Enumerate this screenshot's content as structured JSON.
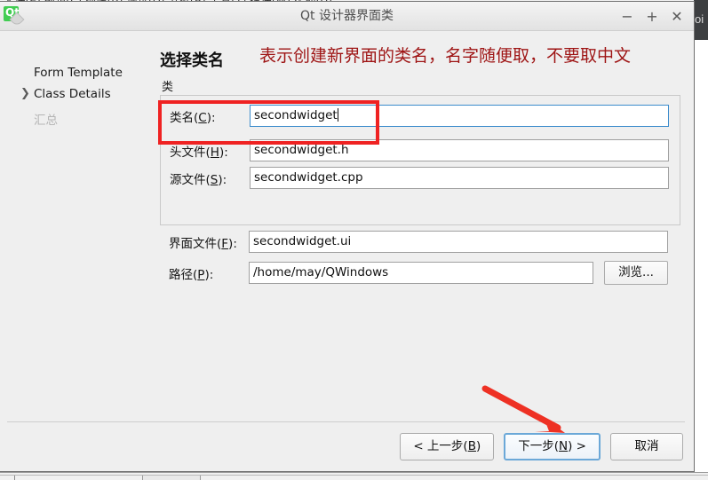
{
  "background_app": {
    "menubar_text": "文件(F)  编辑(E)  构建(B)  调试(D)  分析(A)  工具(T)  控件(W)  帮助(H)",
    "right_edge_label": "oi"
  },
  "dialog": {
    "title": "Qt 设计器界面类",
    "icon": "qt-logo-icon",
    "window_buttons": {
      "minimize": "−",
      "maximize": "+",
      "close": "✕"
    },
    "sidebar": {
      "items": [
        {
          "label": "Form Template",
          "state": "done",
          "chevron": ""
        },
        {
          "label": "Class Details",
          "state": "current",
          "chevron": "❯"
        },
        {
          "label": "汇总",
          "state": "disabled",
          "chevron": ""
        }
      ]
    },
    "main": {
      "heading": "选择类名",
      "group_title": "类",
      "fields": [
        {
          "label_prefix": "类名(",
          "label_key": "C",
          "label_suffix": "):",
          "value": "secondwidget",
          "placeholder": "",
          "focused": true
        },
        {
          "label_prefix": "头文件(",
          "label_key": "H",
          "label_suffix": "):",
          "value": "secondwidget.h",
          "placeholder": "",
          "focused": false
        },
        {
          "label_prefix": "源文件(",
          "label_key": "S",
          "label_suffix": "):",
          "value": "secondwidget.cpp",
          "placeholder": "",
          "focused": false
        },
        {
          "label_prefix": "界面文件(",
          "label_key": "F",
          "label_suffix": "):",
          "value": "secondwidget.ui",
          "placeholder": "",
          "focused": false
        },
        {
          "label_prefix": "路径(",
          "label_key": "P",
          "label_suffix": "):",
          "value": "/home/may/QWindows",
          "placeholder": "",
          "focused": false
        }
      ],
      "browse_button": "浏览..."
    },
    "buttons": {
      "back": {
        "prefix": "< 上一步(",
        "key": "B",
        "suffix": ")"
      },
      "next": {
        "prefix": "下一步(",
        "key": "N",
        "suffix": ") >"
      },
      "cancel": {
        "label": "取消"
      }
    }
  },
  "annotations": {
    "note_text": "表示创建新界面的类名，名字随便取，不要取中文",
    "note_color": "#9e1414",
    "highlight_color": "#ef2222",
    "arrow_target": "next-button"
  }
}
